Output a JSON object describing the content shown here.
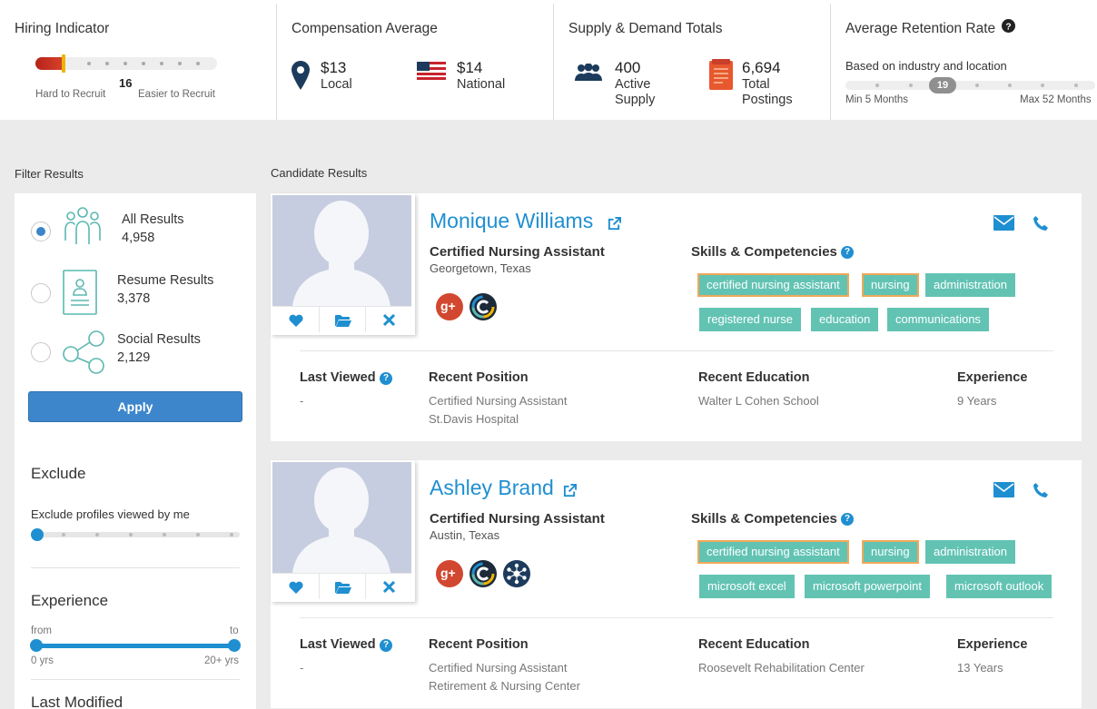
{
  "metrics": {
    "hiring": {
      "title": "Hiring Indicator",
      "value": "16",
      "level": 0.15,
      "left_label": "Hard to Recruit",
      "right_label": "Easier to Recruit"
    },
    "compensation": {
      "title": "Compensation Average",
      "local_value": "$13",
      "local_label": "Local",
      "national_value": "$14",
      "national_label": "National"
    },
    "supply": {
      "title": "Supply & Demand Totals",
      "supply_value": "400",
      "supply_line1": "Active",
      "supply_line2": "Supply",
      "postings_value": "6,694",
      "postings_line1": "Total",
      "postings_line2": "Postings"
    },
    "retention": {
      "title": "Average Retention Rate",
      "subtitle": "Based on industry and location",
      "value": "19",
      "min_label": "Min 5 Months",
      "max_label": "Max 52 Months"
    }
  },
  "filter": {
    "section_label": "Filter Results",
    "options": [
      {
        "title": "All Results",
        "count": "4,958",
        "selected": true
      },
      {
        "title": "Resume Results",
        "count": "3,378",
        "selected": false
      },
      {
        "title": "Social Results",
        "count": "2,129",
        "selected": false
      }
    ],
    "apply_label": "Apply",
    "exclude": {
      "heading": "Exclude",
      "label": "Exclude profiles viewed by me"
    },
    "experience": {
      "heading": "Experience",
      "from_label": "from",
      "to_label": "to",
      "min_label": "0 yrs",
      "max_label": "20+ yrs"
    },
    "last_modified": {
      "heading": "Last Modified"
    }
  },
  "candidates": {
    "section_label": "Candidate Results",
    "skills_heading": "Skills & Competencies",
    "last_viewed_label": "Last Viewed",
    "recent_position_label": "Recent Position",
    "recent_education_label": "Recent Education",
    "experience_label": "Experience",
    "items": [
      {
        "name": "Monique Williams",
        "title": "Certified Nursing Assistant",
        "location": "Georgetown, Texas",
        "skills": [
          "certified nursing assistant",
          "nursing",
          "administration",
          "registered nurse",
          "education",
          "communications"
        ],
        "last_viewed": "-",
        "position": "Certified Nursing Assistant",
        "employer": "St.Davis Hospital",
        "education": "Walter L Cohen School",
        "experience": "9 Years"
      },
      {
        "name": "Ashley Brand",
        "title": "Certified Nursing Assistant",
        "location": "Austin, Texas",
        "skills": [
          "certified nursing assistant",
          "nursing",
          "administration",
          "microsoft excel",
          "microsoft powerpoint",
          "microsoft outlook"
        ],
        "last_viewed": "-",
        "position": "Certified Nursing Assistant",
        "employer": "Retirement & Nursing Center",
        "education": "Roosevelt Rehabilitation Center",
        "experience": "13 Years"
      }
    ]
  },
  "colors": {
    "accent": "#1f8fd1",
    "tag": "#62c3b3",
    "tag_highlight_border": "#f0a95a",
    "apply_button": "#3d86cb",
    "hiring_low": "#b7221a"
  }
}
